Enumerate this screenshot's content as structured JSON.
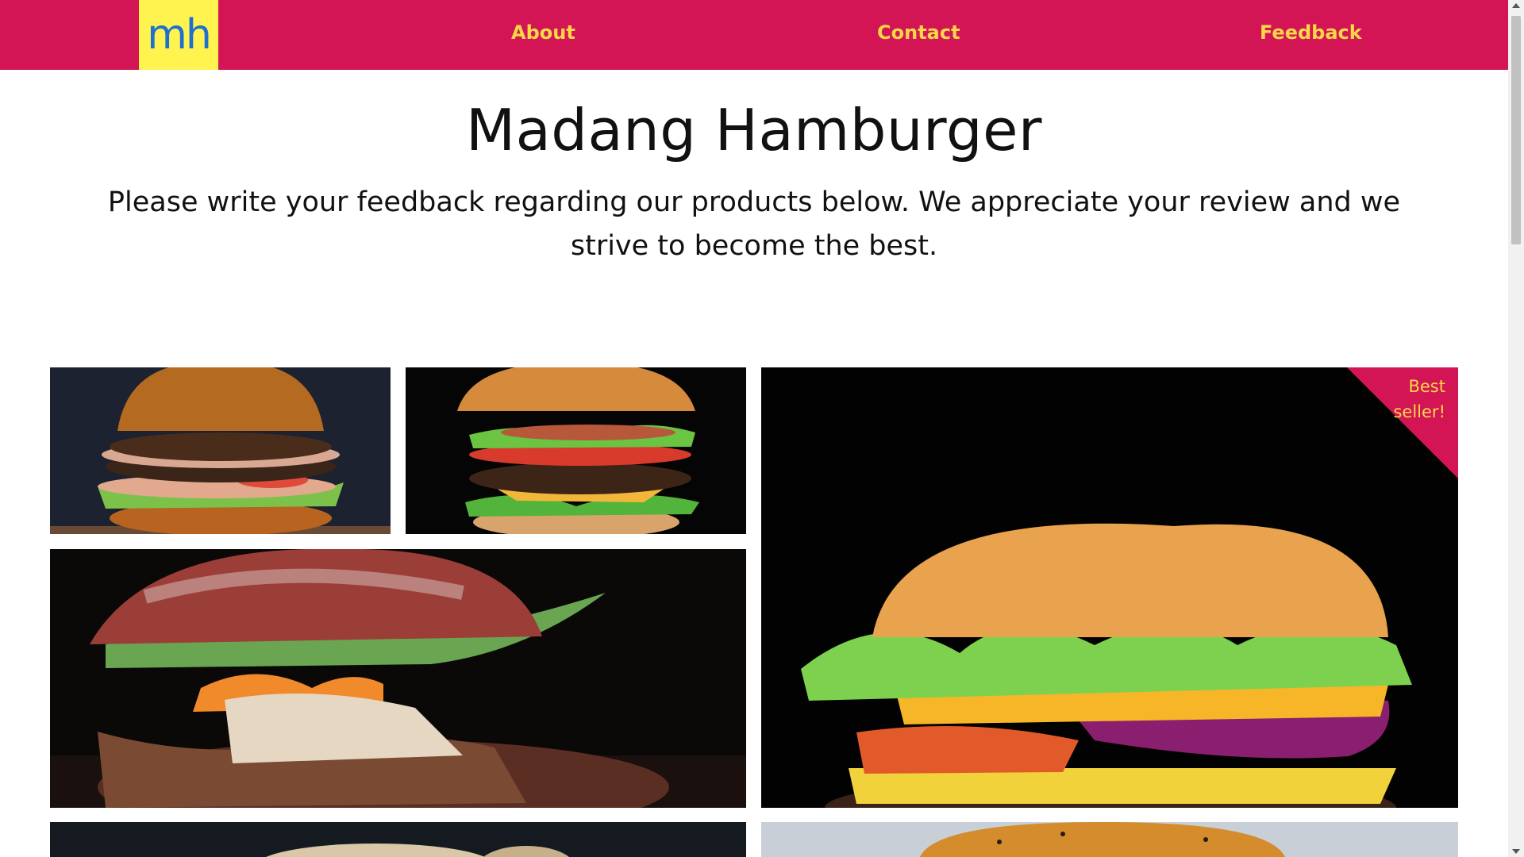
{
  "nav": {
    "logo_text": "mh",
    "links": [
      "About",
      "Contact",
      "Feedback"
    ]
  },
  "header": {
    "title": "Madang Hamburger",
    "subtitle": "Please write your feedback regarding our products below. We appreciate your review and we strive to become the best."
  },
  "gallery": {
    "badge": "Best seller!"
  },
  "colors": {
    "navbar": "#d31455",
    "logo_bg": "#fff44f",
    "logo_text": "#1e6fd0",
    "nav_text": "#f8d847"
  }
}
